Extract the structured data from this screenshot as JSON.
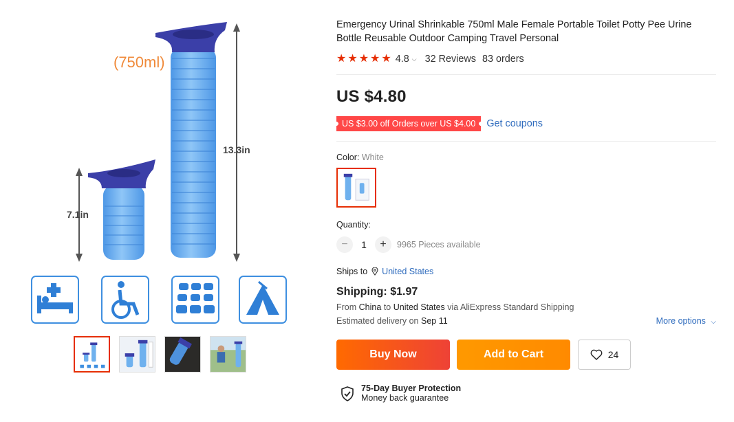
{
  "gallery": {
    "labels": {
      "capacity": "(750ml)",
      "height_tall": "13.3in",
      "height_short": "7.1in"
    },
    "icons": [
      "medical-bed-icon",
      "wheelchair-icon",
      "traffic-jam-icon",
      "tent-icon"
    ],
    "thumbnails": [
      "thumb-1",
      "thumb-2",
      "thumb-3",
      "thumb-4"
    ]
  },
  "product": {
    "title": "Emergency Urinal Shrinkable 750ml Male Female Portable Toilet Potty Pee Urine Bottle Reusable Outdoor Camping Travel Personal",
    "rating": "4.8",
    "reviews": "32 Reviews",
    "orders": "83 orders",
    "price": "US $4.80",
    "coupon": "US $3.00 off Orders over US $4.00",
    "get_coupons": "Get coupons",
    "color_label": "Color:",
    "color_value": "White",
    "quantity_label": "Quantity:",
    "quantity": "1",
    "available": "9965 Pieces available",
    "ships_to_label": "Ships to",
    "ships_to_value": "United States",
    "shipping": "Shipping: $1.97",
    "from_prefix": "From",
    "from_country": "China",
    "to_word": "to",
    "to_country": "United States",
    "via": "via AliExpress Standard Shipping",
    "estimated_prefix": "Estimated delivery on",
    "estimated_date": "Sep 11",
    "more_options": "More options",
    "buy_now": "Buy Now",
    "add_to_cart": "Add to Cart",
    "wishlist_count": "24",
    "protection_title": "75-Day Buyer Protection",
    "protection_sub": "Money back guarantee"
  },
  "colors": {
    "accent": "#e62e04",
    "link": "#2e6bbd",
    "coupon_bg": "#ff4747",
    "product_blue": "#6fb1ee",
    "cap_purple": "#3b3fa8"
  }
}
